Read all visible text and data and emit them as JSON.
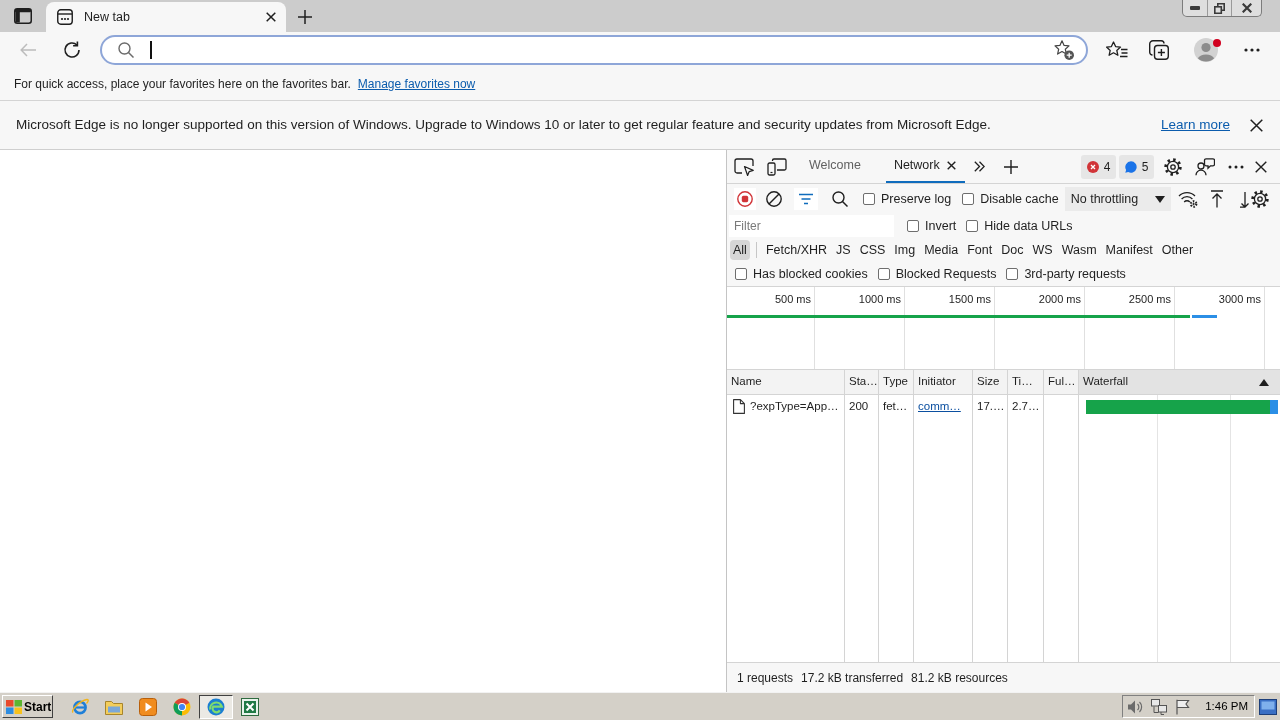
{
  "browser": {
    "tabs": [
      {
        "title": "New tab",
        "selected": true
      }
    ],
    "back_button": {
      "disabled": true
    },
    "address_bar": {
      "focused": true
    },
    "profile": {
      "notification": true
    },
    "favorites_bar": {
      "message": "For quick access, place your favorites here on the favorites bar.",
      "link": "Manage favorites now"
    },
    "info_bar": {
      "message": "Microsoft Edge is no longer supported on this version of Windows. Upgrade to Windows 10 or later to get regular feature and security updates from Microsoft Edge.",
      "link": "Learn more"
    }
  },
  "devtools": {
    "tabs": [
      {
        "label": "Welcome",
        "selected": false,
        "closable": false
      },
      {
        "label": "Network",
        "selected": true,
        "closable": true
      }
    ],
    "issue_counts": [
      {
        "kind": "error",
        "count": "4"
      },
      {
        "kind": "message",
        "count": "5"
      }
    ],
    "toolbar": {
      "recording": true,
      "filter_open": true,
      "options": [
        {
          "label": "Preserve log",
          "checked": false
        },
        {
          "label": "Disable cache",
          "checked": false
        }
      ],
      "throttling": "No throttling"
    },
    "filter": {
      "placeholder": "Filter",
      "options": [
        {
          "label": "Invert",
          "checked": false
        },
        {
          "label": "Hide data URLs",
          "checked": false
        }
      ]
    },
    "type_filters": [
      {
        "label": "All",
        "selected": true
      },
      {
        "label": "Fetch/XHR",
        "selected": false
      },
      {
        "label": "JS",
        "selected": false
      },
      {
        "label": "CSS",
        "selected": false
      },
      {
        "label": "Img",
        "selected": false
      },
      {
        "label": "Media",
        "selected": false
      },
      {
        "label": "Font",
        "selected": false
      },
      {
        "label": "Doc",
        "selected": false
      },
      {
        "label": "WS",
        "selected": false
      },
      {
        "label": "Wasm",
        "selected": false
      },
      {
        "label": "Manifest",
        "selected": false
      },
      {
        "label": "Other",
        "selected": false
      }
    ],
    "request_filters": [
      {
        "label": "Has blocked cookies",
        "checked": false
      },
      {
        "label": "Blocked Requests",
        "checked": false
      },
      {
        "label": "3rd-party requests",
        "checked": false
      }
    ],
    "overview": {
      "ticks": [
        "500 ms",
        "1000 ms",
        "1500 ms",
        "2000 ms",
        "2500 ms",
        "3000 ms"
      ]
    },
    "table": {
      "columns": [
        {
          "label": "Name",
          "sorted": false
        },
        {
          "label": "Sta…",
          "sorted": false
        },
        {
          "label": "Type",
          "sorted": false
        },
        {
          "label": "Initiator",
          "sorted": false
        },
        {
          "label": "Size",
          "sorted": false
        },
        {
          "label": "Ti…",
          "sorted": false
        },
        {
          "label": "Ful…",
          "sorted": false
        },
        {
          "label": "Waterfall",
          "sorted": true
        }
      ],
      "rows": [
        {
          "name": "?expType=App…",
          "status": "200",
          "type": "fet…",
          "initiator": "comm…",
          "size": "17.…",
          "time": "2.7…"
        }
      ]
    },
    "summary": [
      "1 requests",
      "17.2 kB transferred",
      "81.2 kB resources"
    ]
  },
  "taskbar": {
    "start": "Start",
    "apps": [
      {
        "kind": "internet-explorer",
        "active": false
      },
      {
        "kind": "file-explorer",
        "active": false
      },
      {
        "kind": "media-player",
        "active": false
      },
      {
        "kind": "chrome",
        "active": false
      },
      {
        "kind": "edge",
        "active": true
      },
      {
        "kind": "excel",
        "active": false
      }
    ],
    "clock": "1:46 PM"
  }
}
